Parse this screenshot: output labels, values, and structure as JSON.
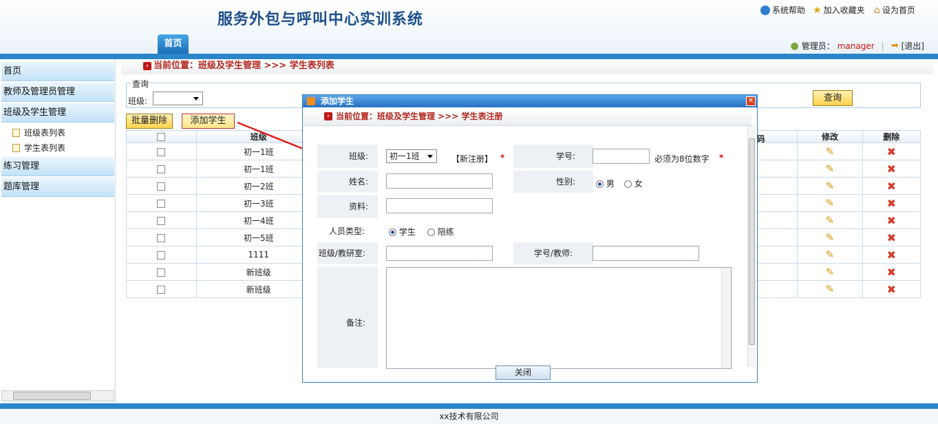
{
  "header": {
    "title": "服务外包与呼叫中心实训系统",
    "links": [
      "系统帮助",
      "加入收藏夹",
      "设为首页"
    ],
    "tab_home": "首页",
    "user_label": "管理员：",
    "user_name": "manager",
    "logout": "[退出]"
  },
  "sidebar": {
    "items": [
      "首页",
      "教师及管理员管理",
      "班级及学生管理",
      "练习管理",
      "题库管理"
    ],
    "subitems": [
      "班级表列表",
      "学生表列表"
    ]
  },
  "breadcrumb": "当前位置：班级及学生管理 >>> 学生表列表",
  "query": {
    "legend": "查询",
    "class_label": "班级:",
    "search_button": "查询"
  },
  "actions": {
    "batch_delete": "批量删除",
    "add_student": "添加学生"
  },
  "table": {
    "headers": [
      "班级",
      "码",
      "修改",
      "删除"
    ],
    "rows": [
      "初一1班",
      "初一1班",
      "初一2班",
      "初一3班",
      "初一4班",
      "初一5班",
      "1111",
      "新班级",
      "新班级"
    ]
  },
  "dialog": {
    "title": "添加学生",
    "breadcrumb": "当前位置：班级及学生管理 >>> 学生表注册",
    "class_label": "班级:",
    "class_value": "初一1班",
    "new_register": "【新注册】",
    "required": "*",
    "student_no_label": "学号:",
    "student_no_hint": "必须为8位数字",
    "name_label": "姓名:",
    "gender_label": "性别:",
    "gender_male": "男",
    "gender_female": "女",
    "info_label": "资料:",
    "type_label": "人员类型:",
    "type_student": "学生",
    "type_trainer": "陪练",
    "dept_label": "班级/教研室:",
    "teacher_no_label": "学号/教师:",
    "remark_label": "备注:",
    "close_button": "关闭"
  },
  "footer": "xx技术有限公司",
  "colors": {
    "accent": "#2a86c9",
    "crumb": "#b3261e",
    "button_yellow": "#ffd34d"
  }
}
